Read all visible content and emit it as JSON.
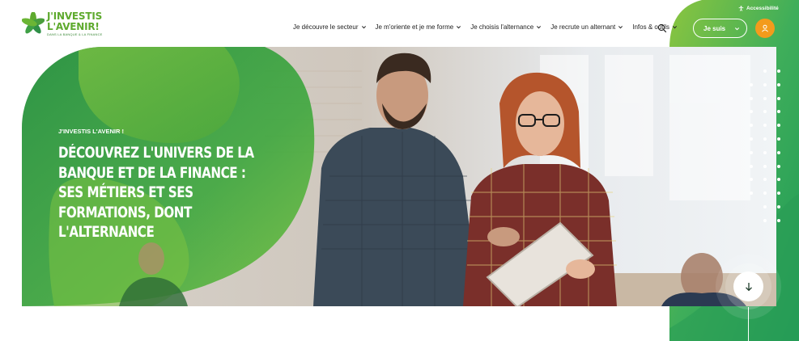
{
  "brand": {
    "line1": "J'INVESTIS",
    "line2": "L'AVENIR!",
    "tagline": "DANS LA BANQUE & LA FINANCE"
  },
  "nav": {
    "items": [
      {
        "label": "Je découvre le secteur"
      },
      {
        "label": "Je m'oriente et je me forme"
      },
      {
        "label": "Je choisis l'alternance"
      },
      {
        "label": "Je recrute un alternant"
      },
      {
        "label": "Infos & outils"
      }
    ]
  },
  "utility": {
    "accessibility_label": "Accessibilité",
    "profile_select_label": "Je suis"
  },
  "hero": {
    "kicker": "J'INVESTIS L'AVENIR !",
    "title": "DÉCOUVREZ L'UNIVERS DE LA BANQUE ET DE LA FINANCE : SES MÉTIERS ET SES FORMATIONS, DONT L'ALTERNANCE"
  },
  "icons": {
    "logo": "star-logo-icon",
    "search": "search-icon",
    "accessibility": "accessibility-icon",
    "user": "user-icon",
    "scroll": "arrow-down-icon",
    "chevron": "chevron-down-icon"
  },
  "colors": {
    "brand_green": "#5eaa2e",
    "dark_green": "#2f9a4f",
    "accent_orange": "#f39b1c",
    "text": "#222222"
  }
}
